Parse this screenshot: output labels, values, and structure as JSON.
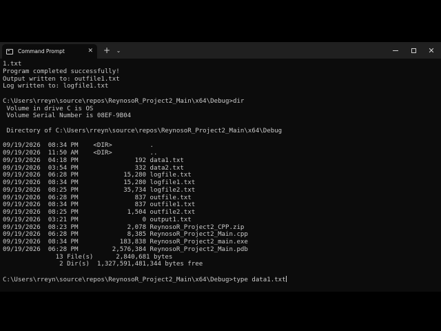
{
  "window": {
    "tab_title": "Command Prompt",
    "tab_close": "✕",
    "new_tab": "+",
    "dropdown": "⌄",
    "close": "✕",
    "icons": [
      "terminal-icon",
      "close-icon",
      "plus-icon",
      "chevron-down-icon",
      "minimize-icon",
      "maximize-icon",
      "close-icon"
    ]
  },
  "console": {
    "lines": [
      "1.txt",
      "Program completed successfully!",
      "Output written to: outfile1.txt",
      "Log written to: logfile1.txt",
      "",
      "C:\\Users\\rreyn\\source\\repos\\ReynosoR_Project2_Main\\x64\\Debug>dir",
      " Volume in drive C is OS",
      " Volume Serial Number is 08EF-9B04",
      "",
      " Directory of C:\\Users\\rreyn\\source\\repos\\ReynosoR_Project2_Main\\x64\\Debug",
      "",
      "09/19/2026  08:34 PM    <DIR>          .",
      "09/19/2026  11:50 AM    <DIR>          ..",
      "09/19/2026  04:18 PM               192 data1.txt",
      "09/19/2026  03:54 PM               332 data2.txt",
      "09/19/2026  06:28 PM            15,280 logfile.txt",
      "09/19/2026  08:34 PM            15,280 logfile1.txt",
      "09/19/2026  08:25 PM            35,734 logfile2.txt",
      "09/19/2026  06:28 PM               837 outfile.txt",
      "09/19/2026  08:34 PM               837 outfile1.txt",
      "09/19/2026  08:25 PM             1,504 outfile2.txt",
      "09/19/2026  03:21 PM                 0 output1.txt",
      "09/19/2026  08:23 PM             2,078 ReynosoR_Project2_CPP.zip",
      "09/19/2026  06:28 PM             8,385 ReynosoR_Project2_Main.cpp",
      "09/19/2026  08:34 PM           183,838 ReynosoR_Project2_main.exe",
      "09/19/2026  06:28 PM         2,576,384 ReynosoR_Project2_Main.pdb",
      "              13 File(s)      2,840,681 bytes",
      "               2 Dir(s)  1,327,591,481,344 bytes free",
      ""
    ],
    "prompt": "C:\\Users\\rreyn\\source\\repos\\ReynosoR_Project2_Main\\x64\\Debug>type data1.txt"
  }
}
